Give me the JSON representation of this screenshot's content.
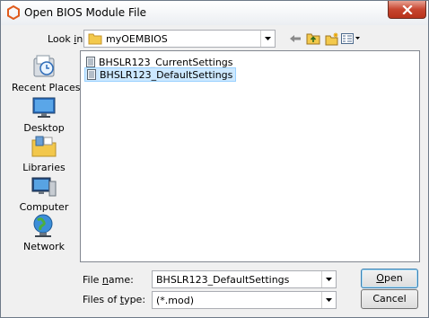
{
  "window": {
    "title": "Open BIOS Module File"
  },
  "lookin": {
    "label_pre": "Look ",
    "label_ul": "i",
    "label_post": "n:",
    "value": "myOEMBIOS"
  },
  "toolbar": {
    "back": "back-arrow-icon",
    "up": "up-folder-icon",
    "new_folder": "new-folder-icon",
    "views": "views-menu-icon"
  },
  "places": [
    {
      "label": "Recent Places",
      "icon": "recent-places-icon"
    },
    {
      "label": "Desktop",
      "icon": "desktop-icon"
    },
    {
      "label": "Libraries",
      "icon": "libraries-icon"
    },
    {
      "label": "Computer",
      "icon": "computer-icon"
    },
    {
      "label": "Network",
      "icon": "network-icon"
    }
  ],
  "files": [
    {
      "name": "BHSLR123_CurrentSettings",
      "selected": false
    },
    {
      "name": "BHSLR123_DefaultSettings",
      "selected": true
    }
  ],
  "filename": {
    "label_pre": "File ",
    "label_ul": "n",
    "label_post": "ame:",
    "value": "BHSLR123_DefaultSettings"
  },
  "filetype": {
    "label_pre": "Files of ",
    "label_ul": "t",
    "label_post": "ype:",
    "value": "(*.mod)"
  },
  "buttons": {
    "open_ul": "O",
    "open_rest": "pen",
    "cancel": "Cancel"
  },
  "colors": {
    "selection": "#cce8ff",
    "close": "#c7452f",
    "dialog_bg": "#f0f0f0"
  }
}
